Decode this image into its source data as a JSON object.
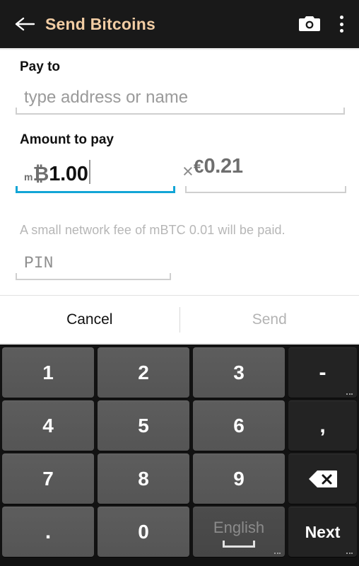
{
  "header": {
    "title": "Send Bitcoins",
    "back_icon": "arrow-left-icon",
    "camera_icon": "camera-icon",
    "overflow_icon": "more-vertical-icon"
  },
  "form": {
    "payto_label": "Pay to",
    "payto_placeholder": "type address or name",
    "payto_value": "",
    "amount_label": "Amount to pay",
    "btc_unit_prefix": "m",
    "btc_symbol": "₿",
    "btc_value": "1.00",
    "separator": "×",
    "eur_symbol": "€",
    "eur_value": "0.21",
    "fee_text": "A small network fee of mBTC 0.01 will be paid.",
    "pin_placeholder": "PIN",
    "pin_value": ""
  },
  "actions": {
    "cancel_label": "Cancel",
    "send_label": "Send",
    "send_enabled": false
  },
  "keyboard": {
    "rows": [
      [
        {
          "label": "1",
          "name": "key-1",
          "type": "num"
        },
        {
          "label": "2",
          "name": "key-2",
          "type": "num"
        },
        {
          "label": "3",
          "name": "key-3",
          "type": "num"
        },
        {
          "label": "-",
          "name": "key-dash",
          "type": "fn"
        }
      ],
      [
        {
          "label": "4",
          "name": "key-4",
          "type": "num"
        },
        {
          "label": "5",
          "name": "key-5",
          "type": "num"
        },
        {
          "label": "6",
          "name": "key-6",
          "type": "num"
        },
        {
          "label": ",",
          "name": "key-comma",
          "type": "fn"
        }
      ],
      [
        {
          "label": "7",
          "name": "key-7",
          "type": "num"
        },
        {
          "label": "8",
          "name": "key-8",
          "type": "num"
        },
        {
          "label": "9",
          "name": "key-9",
          "type": "num"
        },
        {
          "label": "",
          "name": "key-backspace",
          "type": "fn"
        }
      ],
      [
        {
          "label": ".",
          "name": "key-period",
          "type": "num"
        },
        {
          "label": "0",
          "name": "key-0",
          "type": "num"
        },
        {
          "label": "English",
          "name": "key-space",
          "type": "space"
        },
        {
          "label": "Next",
          "name": "key-next",
          "type": "fn"
        }
      ]
    ]
  },
  "colors": {
    "appbar_bg": "#191919",
    "title": "#f2cda4",
    "active_underline": "#12a5d6",
    "inactive_underline": "#cfcfcf",
    "keyboard_bg": "#121212",
    "num_key": "#565656",
    "fn_key": "#232323",
    "muted_text": "#b6b6b6"
  }
}
